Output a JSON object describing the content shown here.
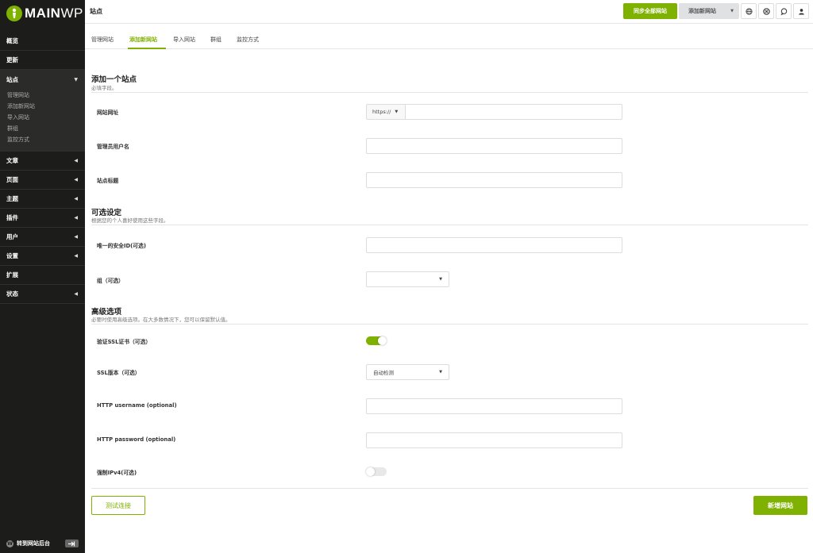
{
  "app": {
    "brand_bold": "MAIN",
    "brand_light": "WP"
  },
  "header": {
    "title": "站点",
    "sync_label": "同步全部网站",
    "add_site_label": "添加新网站",
    "icons": [
      "globe-icon",
      "close-circle-icon",
      "chat-icon",
      "user-icon"
    ]
  },
  "sidebar": {
    "items": [
      {
        "label": "概览"
      },
      {
        "label": "更新"
      },
      {
        "label": "站点"
      },
      {
        "label": "文章"
      },
      {
        "label": "页面"
      },
      {
        "label": "主题"
      },
      {
        "label": "插件"
      },
      {
        "label": "用户"
      },
      {
        "label": "设置"
      },
      {
        "label": "扩展"
      },
      {
        "label": "状态"
      }
    ],
    "subitems": [
      "管理网站",
      "添加新网站",
      "导入网站",
      "群组",
      "监控方式"
    ],
    "footer_label": "转到网站后台"
  },
  "tabs": [
    {
      "label": "管理网站"
    },
    {
      "label": "添加新网站",
      "active": true
    },
    {
      "label": "导入网站"
    },
    {
      "label": "群组"
    },
    {
      "label": "监控方式"
    }
  ],
  "form": {
    "section1": {
      "title": "添加一个站点",
      "subtitle": "必填字段。"
    },
    "url_label": "网站网址",
    "protocol": "https://",
    "admin_label": "管理员用户名",
    "sitetitle_label": "站点标题",
    "section2": {
      "title": "可选设定",
      "subtitle": "根据您的个人喜好使用这些字段。"
    },
    "uniqueid_label": "唯一的安全ID(可选)",
    "group_label": "组（可选）",
    "section3": {
      "title": "高级选项",
      "subtitle": "必要时使用高级选项。在大多数情况下，您可以保留默认值。"
    },
    "ssl_verify_label": "验证SSL证书（可选）",
    "ssl_verify_on": true,
    "ssl_version_label": "SSL版本（可选）",
    "ssl_version_value": "自动检测",
    "http_user_label": "HTTP username (optional)",
    "http_pass_label": "HTTP password (optional)",
    "ipv4_label": "强制IPv4(可选)",
    "ipv4_on": false,
    "test_button": "测试连接",
    "submit_button": "新增网站"
  },
  "colors": {
    "accent": "#7fb100",
    "sidebar_bg": "#1c1d1b"
  }
}
